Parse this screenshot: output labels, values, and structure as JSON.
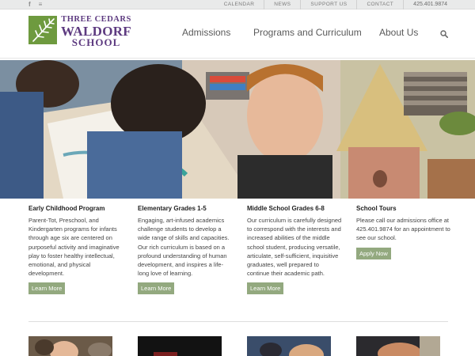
{
  "topbar": {
    "social": [
      {
        "icon": "facebook-icon",
        "glyph": "f"
      },
      {
        "icon": "rss-icon",
        "glyph": "≡"
      }
    ],
    "links": [
      "CALENDAR",
      "NEWS",
      "SUPPORT US",
      "CONTACT"
    ],
    "phone": "425.401.9874"
  },
  "logo": {
    "line1": "THREE CEDARS",
    "line2": "WALDORF",
    "line3": "SCHOOL",
    "colors": {
      "mark": "#6e9a3f",
      "text": "#5d3a80"
    }
  },
  "nav": {
    "items": [
      "Admissions",
      "Programs and Curriculum",
      "About Us"
    ]
  },
  "columns": [
    {
      "title": "Early Childhood Program",
      "body": "Parent-Tot, Preschool, and Kindergarten programs for infants through age six are centered on purposeful activity and imaginative play to foster healthy intellectual, emotional, and physical development.",
      "button": "Learn More"
    },
    {
      "title": "Elementary Grades 1-5",
      "body": "Engaging, art-infused academics challenge students to develop a wide range of skills and capacities. Our rich curriculum is based on a profound understanding of human development, and inspires a life-long love of learning.",
      "button": "Learn More"
    },
    {
      "title": "Middle School Grades 6-8",
      "body": "Our curriculum is carefully designed to correspond with the interests and increased abilities of the middle school student, producing versatile, articulate, self-sufficient, inquisitive graduates, well prepared to continue their academic path.",
      "button": "Learn More"
    },
    {
      "title": "School Tours",
      "body": "Please call our admissions office at 425.401.9874 for an appointment to see our school.",
      "button": "Apply Now"
    }
  ],
  "theme": {
    "button_bg": "#93a97f",
    "topbar_bg": "#e9eaea"
  }
}
